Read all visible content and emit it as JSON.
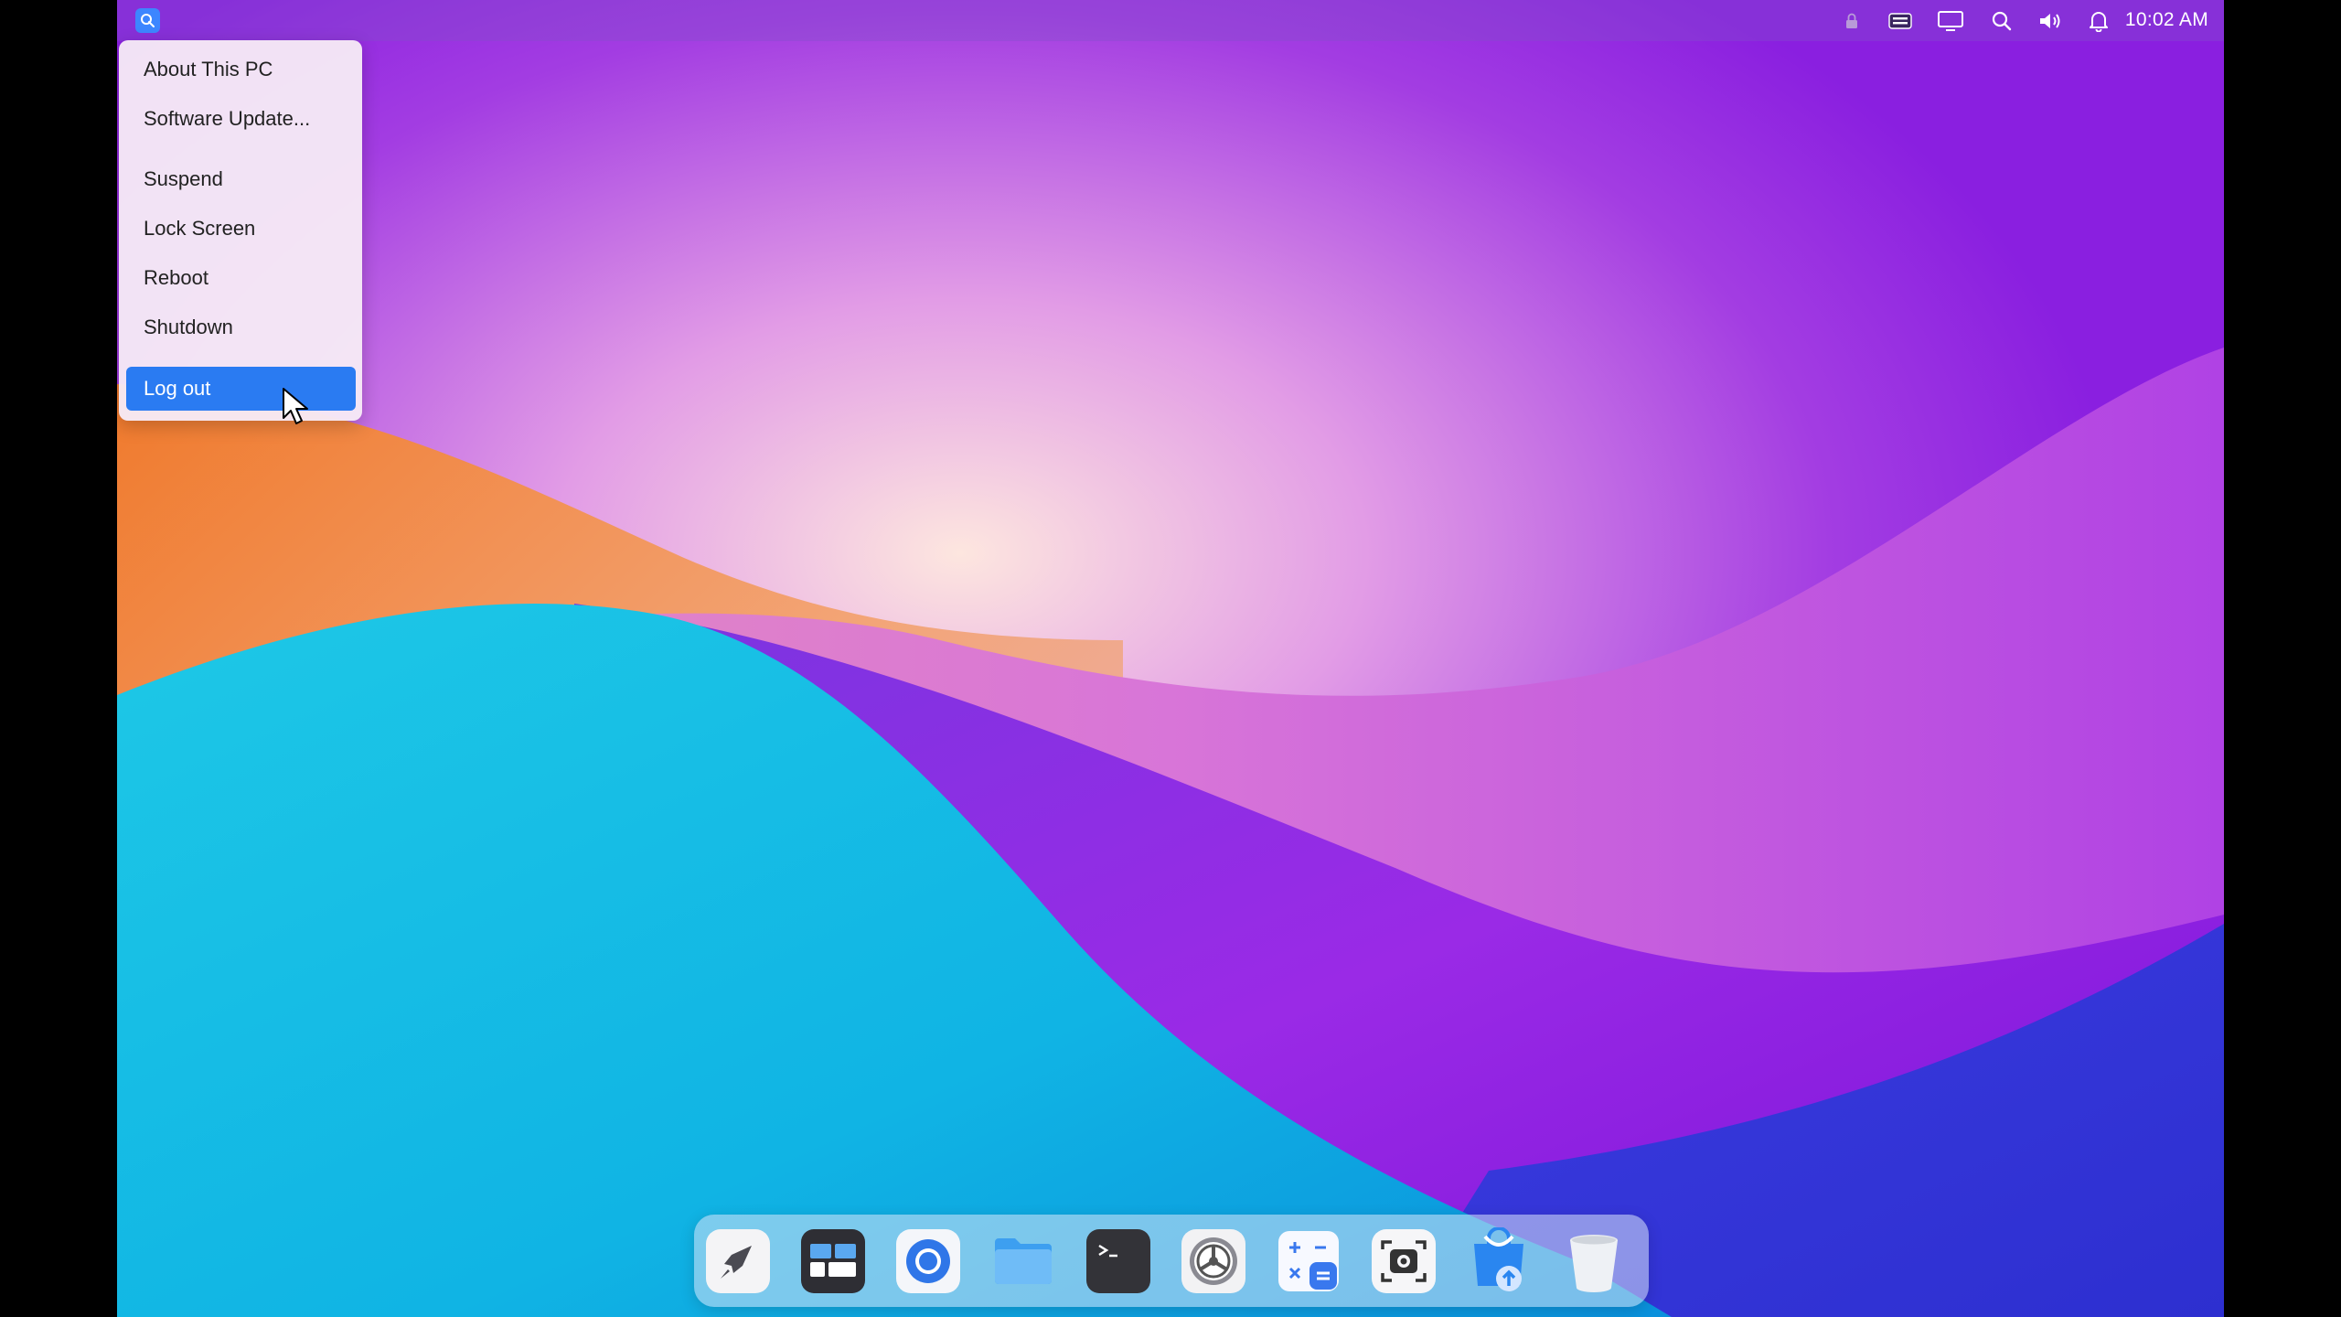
{
  "topbar": {
    "clock": "10:02 AM",
    "tray_icons": [
      "lock-icon",
      "keyboard-icon",
      "display-icon",
      "search-icon",
      "volume-icon",
      "bell-icon"
    ]
  },
  "app_menu": {
    "items": [
      {
        "label": "About This PC"
      },
      {
        "label": "Software Update..."
      },
      {
        "label": "Suspend"
      },
      {
        "label": "Lock Screen"
      },
      {
        "label": "Reboot"
      },
      {
        "label": "Shutdown"
      },
      {
        "label": "Log out",
        "active": true
      }
    ]
  },
  "dock": {
    "apps": [
      "launcher-icon",
      "multitasking-icon",
      "browser-icon",
      "files-icon",
      "terminal-icon",
      "settings-icon",
      "calculator-icon",
      "screenshot-icon",
      "store-icon",
      "trash-icon"
    ]
  },
  "colors": {
    "accent": "#2a7bf2",
    "menu_bg": "#f6eaf6"
  }
}
